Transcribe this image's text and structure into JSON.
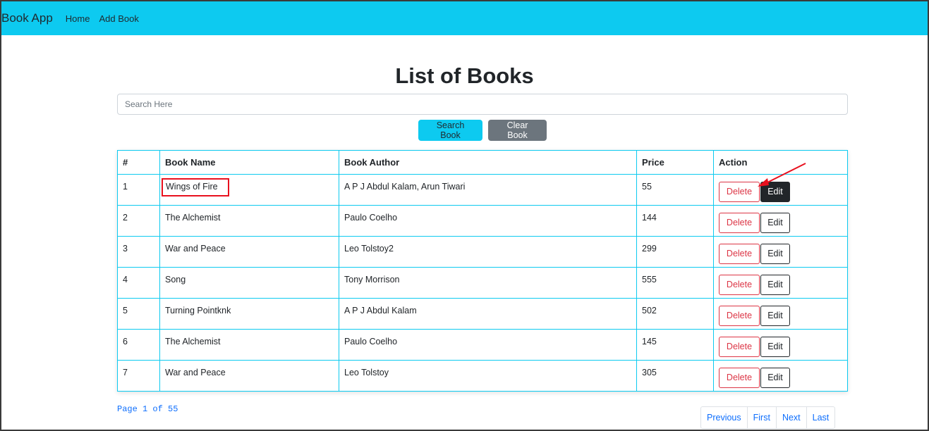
{
  "navbar": {
    "brand": "Book App",
    "links": [
      "Home",
      "Add Book"
    ]
  },
  "page": {
    "title": "List of Books"
  },
  "search": {
    "placeholder": "Search Here",
    "value": ""
  },
  "buttons": {
    "search": "Search Book",
    "clear": "Clear Book"
  },
  "table": {
    "headers": [
      "#",
      "Book Name",
      "Book Author",
      "Price",
      "Action"
    ],
    "rows": [
      {
        "num": "1",
        "name": "Wings of Fire",
        "author": "A P J Abdul Kalam, Arun Tiwari",
        "price": "55"
      },
      {
        "num": "2",
        "name": "The Alchemist",
        "author": "Paulo Coelho",
        "price": "144"
      },
      {
        "num": "3",
        "name": "War and Peace",
        "author": "Leo Tolstoy2",
        "price": "299"
      },
      {
        "num": "4",
        "name": "Song",
        "author": "Tony Morrison",
        "price": "555"
      },
      {
        "num": "5",
        "name": "Turning Pointknk",
        "author": "A P J Abdul Kalam",
        "price": "502"
      },
      {
        "num": "6",
        "name": "The Alchemist",
        "author": "Paulo Coelho",
        "price": "145"
      },
      {
        "num": "7",
        "name": "War and Peace",
        "author": "Leo Tolstoy",
        "price": "305"
      }
    ],
    "actions": {
      "delete": "Delete",
      "edit": "Edit"
    }
  },
  "pagination": {
    "info": "Page 1 of 55",
    "buttons": [
      "Previous",
      "First",
      "Next",
      "Last"
    ]
  },
  "colors": {
    "navbar": "#0dcaf0",
    "table_border": "#0dcaf0",
    "delete": "#dc3545",
    "edit_active": "#212529",
    "link": "#0d6efd",
    "annotation": "#e8101e"
  },
  "annotations": {
    "highlight_row": 1,
    "arrow_target": "edit-button-row-1"
  }
}
